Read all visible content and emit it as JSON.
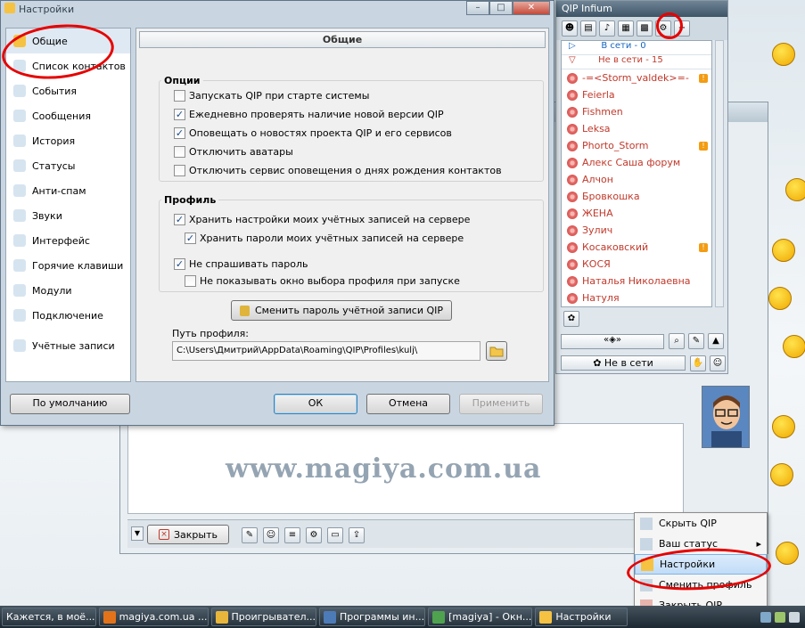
{
  "settings": {
    "title": "Настройки",
    "nav": [
      {
        "label": "Общие",
        "icon": "key-icon"
      },
      {
        "label": "Список контактов",
        "icon": "contacts-icon"
      },
      {
        "label": "События",
        "icon": "events-icon"
      },
      {
        "label": "Сообщения",
        "icon": "messages-icon"
      },
      {
        "label": "История",
        "icon": "history-icon"
      },
      {
        "label": "Статусы",
        "icon": "status-icon"
      },
      {
        "label": "Анти-спам",
        "icon": "shield-icon"
      },
      {
        "label": "Звуки",
        "icon": "music-note-icon"
      },
      {
        "label": "Интерфейс",
        "icon": "interface-icon"
      },
      {
        "label": "Горячие клавиши",
        "icon": "keyboard-icon"
      },
      {
        "label": "Модули",
        "icon": "modules-icon"
      },
      {
        "label": "Подключение",
        "icon": "plug-icon"
      },
      {
        "label": "Учётные записи",
        "icon": "accounts-icon"
      }
    ],
    "panel_title": "Общие",
    "options_legend": "Опции",
    "options": [
      {
        "label": "Запускать QIP при старте системы",
        "checked": false
      },
      {
        "label": "Ежедневно проверять наличие новой версии QIP",
        "checked": true
      },
      {
        "label": "Оповещать о новостях проекта QIP и его сервисов",
        "checked": true
      },
      {
        "label": "Отключить аватары",
        "checked": false
      },
      {
        "label": "Отключить сервис оповещения о днях рождения контактов",
        "checked": false
      }
    ],
    "profile_legend": "Профиль",
    "profile_options": [
      {
        "label": "Хранить настройки моих учётных записей на сервере",
        "checked": true
      },
      {
        "label": "Хранить пароли моих учётных записей на сервере",
        "checked": true
      },
      {
        "label": "Не спрашивать пароль",
        "checked": true
      },
      {
        "label": "Не показывать окно выбора профиля при запуске",
        "checked": false
      }
    ],
    "change_password_label": "Сменить пароль учётной записи QIP",
    "profile_path_label": "Путь профиля:",
    "profile_path_value": "C:\\Users\\Дмитрий\\AppData\\Roaming\\QIP\\Profiles\\kulj\\",
    "defaults_label": "По умолчанию",
    "ok_label": "ОК",
    "cancel_label": "Отмена",
    "apply_label": "Применить"
  },
  "qip": {
    "title": "QIP Infium",
    "online_group": "В сети - 0",
    "offline_group": "Не в сети - 15",
    "contacts": [
      {
        "name": "-=<Storm_valdek>=-",
        "badge": "!"
      },
      {
        "name": "Feierla",
        "badge": ""
      },
      {
        "name": "Fishmen",
        "badge": ""
      },
      {
        "name": "Leksa",
        "badge": ""
      },
      {
        "name": "Phorto_Storm",
        "badge": "!"
      },
      {
        "name": "Алекс Саша форум",
        "badge": ""
      },
      {
        "name": "Алчон",
        "badge": ""
      },
      {
        "name": "Бровкошка",
        "badge": ""
      },
      {
        "name": "ЖЕНА",
        "badge": ""
      },
      {
        "name": "Зулич",
        "badge": ""
      },
      {
        "name": "Косаковский",
        "badge": "!"
      },
      {
        "name": "КОСЯ",
        "badge": ""
      },
      {
        "name": "Наталья Николаевна",
        "badge": ""
      },
      {
        "name": "Натуля",
        "badge": ""
      }
    ],
    "status_label": "Не в сети"
  },
  "chat": {
    "close_label": "Закрыть",
    "watermark": "www.magiya.com.ua"
  },
  "context_menu": {
    "items": [
      {
        "label": "Скрыть QIP",
        "icon": "hide-icon"
      },
      {
        "label": "Ваш статус",
        "icon": "status-icon",
        "submenu": true
      },
      {
        "label": "Настройки",
        "icon": "settings-icon",
        "highlighted": true
      },
      {
        "label": "Сменить профиль",
        "icon": "profile-icon"
      },
      {
        "label": "Закрыть QIP",
        "icon": "close-icon"
      }
    ]
  },
  "taskbar": {
    "tasks": [
      {
        "label": "Кажется, в моё..."
      },
      {
        "label": "magiya.com.ua ..."
      },
      {
        "label": "Проигрывател..."
      },
      {
        "label": "Программы ин..."
      },
      {
        "label": "[magiya] - Окн..."
      },
      {
        "label": "Настройки"
      }
    ]
  },
  "colors": {
    "accent": "#e60000",
    "offline_contact": "#c0392b",
    "online_group": "#1565c0"
  }
}
